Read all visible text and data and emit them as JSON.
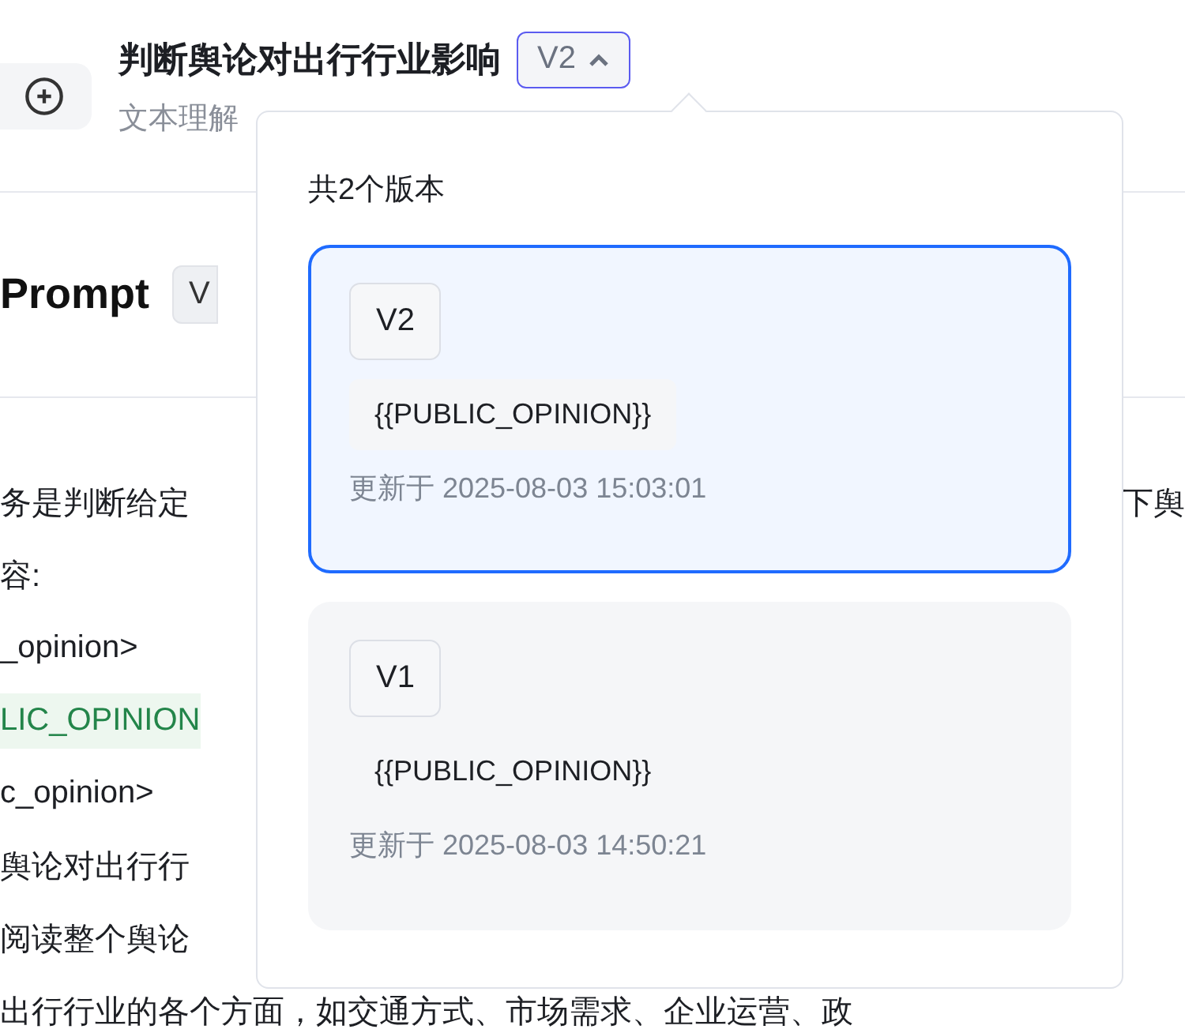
{
  "header": {
    "title": "判断舆论对出行行业影响",
    "version_button": {
      "label": "V2",
      "expanded": true
    },
    "subtitle": "文本理解"
  },
  "prompt_section": {
    "title": "Prompt",
    "badge": "V"
  },
  "content_lines": [
    {
      "kind": "text",
      "text": "务是判断给定",
      "tail": "下舆"
    },
    {
      "kind": "text",
      "text": "容:"
    },
    {
      "kind": "text",
      "text": "_opinion>"
    },
    {
      "kind": "variable",
      "text": "LIC_OPINION"
    },
    {
      "kind": "text",
      "text": "c_opinion>"
    },
    {
      "kind": "text",
      "text": "舆论对出行行"
    },
    {
      "kind": "text",
      "text": "阅读整个舆论"
    },
    {
      "kind": "text",
      "text": "出行行业的各个方面，如交通方式、市场需求、企业运营、政"
    }
  ],
  "version_popover": {
    "heading": "共2个版本",
    "versions": [
      {
        "tag": "V2",
        "variable": "{{PUBLIC_OPINION}}",
        "updated": "更新于 2025-08-03 15:03:01",
        "selected": true
      },
      {
        "tag": "V1",
        "variable": "{{PUBLIC_OPINION}}",
        "updated": "更新于 2025-08-03 14:50:21",
        "selected": false
      }
    ]
  }
}
